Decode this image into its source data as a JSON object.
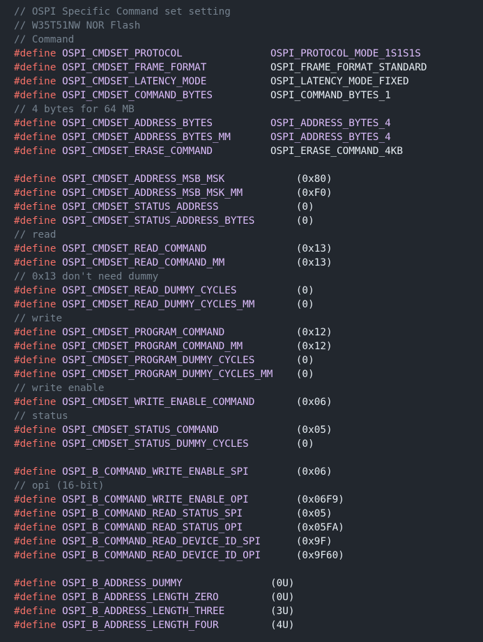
{
  "code": {
    "lines": [
      {
        "type": "comment",
        "text": "// OSPI Specific Command set setting"
      },
      {
        "type": "comment",
        "text": "// W35T51NW NOR Flash"
      },
      {
        "type": "comment",
        "text": "// Command"
      },
      {
        "type": "define",
        "name": "OSPI_CMDSET_PROTOCOL",
        "value": "OSPI_PROTOCOL_MODE_1S1S1S",
        "valueColor": "#dcbdfb",
        "col": 40
      },
      {
        "type": "define",
        "name": "OSPI_CMDSET_FRAME_FORMAT",
        "value": "OSPI_FRAME_FORMAT_STANDARD",
        "valueColor": "#e6edf3",
        "col": 40
      },
      {
        "type": "define",
        "name": "OSPI_CMDSET_LATENCY_MODE",
        "value": "OSPI_LATENCY_MODE_FIXED",
        "valueColor": "#e6edf3",
        "col": 40
      },
      {
        "type": "define",
        "name": "OSPI_CMDSET_COMMAND_BYTES",
        "value": "OSPI_COMMAND_BYTES_1",
        "valueColor": "#e6edf3",
        "col": 40
      },
      {
        "type": "comment",
        "text": "// 4 bytes for 64 MB"
      },
      {
        "type": "define",
        "name": "OSPI_CMDSET_ADDRESS_BYTES",
        "value": "OSPI_ADDRESS_BYTES_4",
        "valueColor": "#dcbdfb",
        "col": 40
      },
      {
        "type": "define",
        "name": "OSPI_CMDSET_ADDRESS_BYTES_MM",
        "value": "OSPI_ADDRESS_BYTES_4",
        "valueColor": "#dcbdfb",
        "col": 40
      },
      {
        "type": "define",
        "name": "OSPI_CMDSET_ERASE_COMMAND",
        "value": "OSPI_ERASE_COMMAND_4KB",
        "valueColor": "#e6edf3",
        "col": 40
      },
      {
        "type": "blank"
      },
      {
        "type": "define",
        "name": "OSPI_CMDSET_ADDRESS_MSB_MSK",
        "value": "(0x80)",
        "valueColor": "#e6edf3",
        "col": 44
      },
      {
        "type": "define",
        "name": "OSPI_CMDSET_ADDRESS_MSB_MSK_MM",
        "value": "(0xF0)",
        "valueColor": "#e6edf3",
        "col": 44
      },
      {
        "type": "define",
        "name": "OSPI_CMDSET_STATUS_ADDRESS",
        "value": "(0)",
        "valueColor": "#e6edf3",
        "col": 44
      },
      {
        "type": "define",
        "name": "OSPI_CMDSET_STATUS_ADDRESS_BYTES",
        "value": "(0)",
        "valueColor": "#e6edf3",
        "col": 44
      },
      {
        "type": "comment",
        "text": "// read"
      },
      {
        "type": "define",
        "name": "OSPI_CMDSET_READ_COMMAND",
        "value": "(0x13)",
        "valueColor": "#e6edf3",
        "col": 44
      },
      {
        "type": "define",
        "name": "OSPI_CMDSET_READ_COMMAND_MM",
        "value": "(0x13)",
        "valueColor": "#e6edf3",
        "col": 44
      },
      {
        "type": "comment",
        "text": "// 0x13 don't need dummy"
      },
      {
        "type": "define",
        "name": "OSPI_CMDSET_READ_DUMMY_CYCLES",
        "value": "(0)",
        "valueColor": "#e6edf3",
        "col": 44
      },
      {
        "type": "define",
        "name": "OSPI_CMDSET_READ_DUMMY_CYCLES_MM",
        "value": "(0)",
        "valueColor": "#e6edf3",
        "col": 44
      },
      {
        "type": "comment",
        "text": "// write"
      },
      {
        "type": "define",
        "name": "OSPI_CMDSET_PROGRAM_COMMAND",
        "value": "(0x12)",
        "valueColor": "#e6edf3",
        "col": 44
      },
      {
        "type": "define",
        "name": "OSPI_CMDSET_PROGRAM_COMMAND_MM",
        "value": "(0x12)",
        "valueColor": "#e6edf3",
        "col": 44
      },
      {
        "type": "define",
        "name": "OSPI_CMDSET_PROGRAM_DUMMY_CYCLES",
        "value": "(0)",
        "valueColor": "#e6edf3",
        "col": 44
      },
      {
        "type": "define",
        "name": "OSPI_CMDSET_PROGRAM_DUMMY_CYCLES_MM",
        "value": "(0)",
        "valueColor": "#e6edf3",
        "col": 44
      },
      {
        "type": "comment",
        "text": "// write enable"
      },
      {
        "type": "define",
        "name": "OSPI_CMDSET_WRITE_ENABLE_COMMAND",
        "value": "(0x06)",
        "valueColor": "#e6edf3",
        "col": 44
      },
      {
        "type": "comment",
        "text": "// status"
      },
      {
        "type": "define",
        "name": "OSPI_CMDSET_STATUS_COMMAND",
        "value": "(0x05)",
        "valueColor": "#e6edf3",
        "col": 44
      },
      {
        "type": "define",
        "name": "OSPI_CMDSET_STATUS_DUMMY_CYCLES",
        "value": "(0)",
        "valueColor": "#e6edf3",
        "col": 44
      },
      {
        "type": "blank"
      },
      {
        "type": "define",
        "name": "OSPI_B_COMMAND_WRITE_ENABLE_SPI",
        "value": "(0x06)",
        "valueColor": "#e6edf3",
        "col": 44
      },
      {
        "type": "comment",
        "text": "// opi (16-bit)"
      },
      {
        "type": "define",
        "name": "OSPI_B_COMMAND_WRITE_ENABLE_OPI",
        "value": "(0x06F9)",
        "valueColor": "#e6edf3",
        "col": 44
      },
      {
        "type": "define",
        "name": "OSPI_B_COMMAND_READ_STATUS_SPI",
        "value": "(0x05)",
        "valueColor": "#e6edf3",
        "col": 44
      },
      {
        "type": "define",
        "name": "OSPI_B_COMMAND_READ_STATUS_OPI",
        "value": "(0x05FA)",
        "valueColor": "#e6edf3",
        "col": 44
      },
      {
        "type": "define",
        "name": "OSPI_B_COMMAND_READ_DEVICE_ID_SPI",
        "value": "(0x9F)",
        "valueColor": "#e6edf3",
        "col": 44
      },
      {
        "type": "define",
        "name": "OSPI_B_COMMAND_READ_DEVICE_ID_OPI",
        "value": "(0x9F60)",
        "valueColor": "#e6edf3",
        "col": 44
      },
      {
        "type": "blank"
      },
      {
        "type": "define",
        "name": "OSPI_B_ADDRESS_DUMMY",
        "value": "(0U)",
        "valueColor": "#e6edf3",
        "col": 40
      },
      {
        "type": "define",
        "name": "OSPI_B_ADDRESS_LENGTH_ZERO",
        "value": "(0U)",
        "valueColor": "#e6edf3",
        "col": 40
      },
      {
        "type": "define",
        "name": "OSPI_B_ADDRESS_LENGTH_THREE",
        "value": "(3U)",
        "valueColor": "#e6edf3",
        "col": 40
      },
      {
        "type": "define",
        "name": "OSPI_B_ADDRESS_LENGTH_FOUR",
        "value": "(4U)",
        "valueColor": "#e6edf3",
        "col": 40
      }
    ],
    "keyword": "#define",
    "colors": {
      "background": "#22272e",
      "comment": "#768390",
      "keyword": "#f47067",
      "macro": "#dcbdfb",
      "plain": "#e6edf3"
    }
  }
}
